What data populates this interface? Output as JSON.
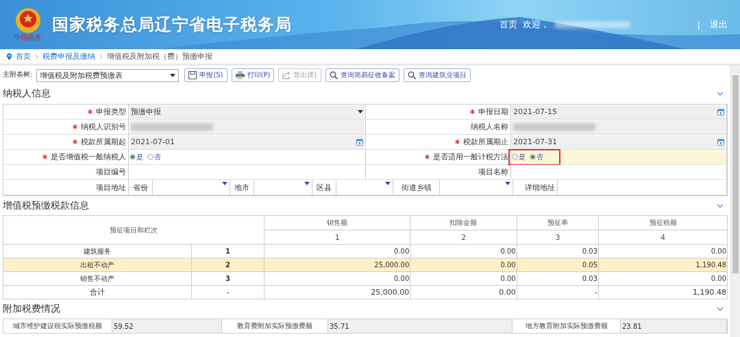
{
  "header": {
    "title": "国家税务总局辽宁省电子税务局",
    "logo_caption": "中国税务",
    "nav": [
      {
        "kind": "link",
        "label": "首页"
      },
      {
        "kind": "welcome",
        "label": "欢迎，"
      },
      {
        "kind": "separator",
        "label": "|"
      },
      {
        "kind": "link",
        "label": "退出"
      }
    ]
  },
  "breadcrumb": [
    {
      "label": "首页",
      "link": true
    },
    {
      "label": "税费申报及缴纳",
      "link": true
    },
    {
      "label": "增值税及附加税（费）预缴申报",
      "link": false
    }
  ],
  "toolbar": {
    "tree_label": "主附表树:",
    "tree_value": "增值税及附加税费预缴表",
    "buttons": [
      {
        "kind": "save",
        "label": "申报(S)",
        "disabled": false
      },
      {
        "kind": "print",
        "label": "打印(P)",
        "disabled": false
      },
      {
        "kind": "export",
        "label": "导出(E)",
        "disabled": true
      },
      {
        "kind": "search",
        "label": "查询简易征收备案",
        "disabled": false
      },
      {
        "kind": "search",
        "label": "查询建筑业项目",
        "disabled": false
      }
    ]
  },
  "taxpayer_info": {
    "title": "纳税人信息",
    "expanded": true,
    "rows": [
      {
        "cells": [
          {
            "label": "申报类型",
            "required": true,
            "kind": "select",
            "value": "预缴申报",
            "disabled": true
          },
          {
            "label": "申报日期",
            "required": true,
            "kind": "date",
            "value": "2021-07-15",
            "disabled": true
          }
        ]
      },
      {
        "cells": [
          {
            "label": "纳税人识别号",
            "required": true,
            "kind": "redacted",
            "disabled": true
          },
          {
            "label": "纳税人名称",
            "required": false,
            "kind": "redacted",
            "disabled": true
          }
        ]
      },
      {
        "cells": [
          {
            "label": "税款所属期起",
            "required": true,
            "kind": "date",
            "value": "2021-07-01",
            "disabled": true
          },
          {
            "label": "税款所属期止",
            "required": true,
            "kind": "date",
            "value": "2021-07-31",
            "disabled": true
          }
        ]
      },
      {
        "cells": [
          {
            "label": "是否增值税一般纳税人",
            "required": true,
            "kind": "radio",
            "highlighted": false,
            "options": [
              {
                "label": "是",
                "selected": true
              },
              {
                "label": "否",
                "selected": false
              }
            ]
          },
          {
            "label": "是否适用一般计税方法",
            "required": true,
            "kind": "radio",
            "highlighted": true,
            "options": [
              {
                "label": "是",
                "selected": false
              },
              {
                "label": "否",
                "selected": true
              }
            ]
          }
        ]
      },
      {
        "cells": [
          {
            "label": "项目编号",
            "required": false,
            "kind": "text"
          },
          {
            "label": "项目名称",
            "required": false,
            "kind": "text"
          }
        ]
      }
    ],
    "address": {
      "label": "项目地址",
      "parts": [
        {
          "label": "省份"
        },
        {
          "label": "地市"
        },
        {
          "label": "区县"
        },
        {
          "label": "街道乡镇"
        }
      ],
      "detail_label": "详细地址"
    }
  },
  "prepay_info": {
    "title": "增值税预缴税款信息",
    "expanded": true,
    "item_header": "预征项目和栏次",
    "columns": [
      {
        "label": "销售额",
        "number": "1"
      },
      {
        "label": "扣除金额",
        "number": "2"
      },
      {
        "label": "预征率",
        "number": "3"
      },
      {
        "label": "预征税额",
        "number": "4"
      }
    ],
    "rows": [
      {
        "kind": "item",
        "item": "建筑服务",
        "line": "1",
        "values": [
          "0.00",
          "0.00",
          "0.03",
          "0.00"
        ],
        "selected": false
      },
      {
        "kind": "item",
        "item": "出租不动产",
        "line": "2",
        "values": [
          "25,000.00",
          "0.00",
          "0.05",
          "1,190.48"
        ],
        "selected": true
      },
      {
        "kind": "item",
        "item": "销售不动产",
        "line": "3",
        "values": [
          "0.00",
          "0.00",
          "0.03",
          "0.00"
        ],
        "selected": false
      },
      {
        "kind": "total",
        "item": "合计",
        "line": "-",
        "values": [
          "25,000.00",
          "0.00",
          "-",
          "1,190.48"
        ],
        "selected": false
      }
    ]
  },
  "surcharge_info": {
    "title": "附加税费情况",
    "expanded": true,
    "items": [
      {
        "label": "城市维护建设税实际预缴税额",
        "value": "59.52"
      },
      {
        "label": "教育费附加实际预缴费额",
        "value": "35.71"
      },
      {
        "label": "地方教育附加实际预缴费额",
        "value": "23.81"
      }
    ]
  }
}
